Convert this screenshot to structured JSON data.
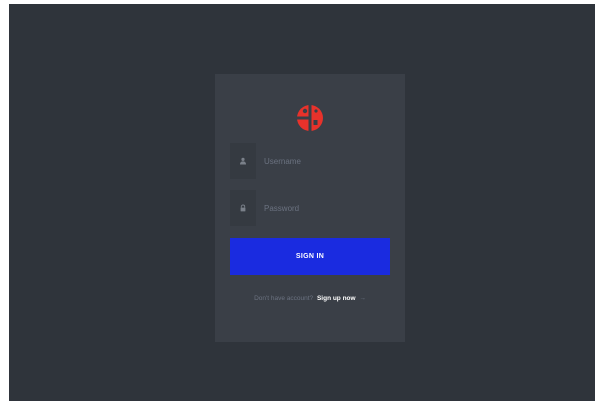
{
  "login": {
    "username": {
      "placeholder": "Username",
      "value": "",
      "icon": "user-icon"
    },
    "password": {
      "placeholder": "Password",
      "value": "",
      "icon": "lock-icon"
    },
    "signin_label": "SIGN IN",
    "signup_prompt": "Don't have account?",
    "signup_link": "Sign up now",
    "signup_arrow": "→"
  },
  "colors": {
    "background": "#2f343b",
    "card": "#3a3f47",
    "input_icon_bg": "#353a41",
    "primary_button": "#1a2be0",
    "logo": "#e8322b",
    "muted_text": "#6b7280"
  },
  "logo": {
    "icon": "brand-logo-icon"
  }
}
